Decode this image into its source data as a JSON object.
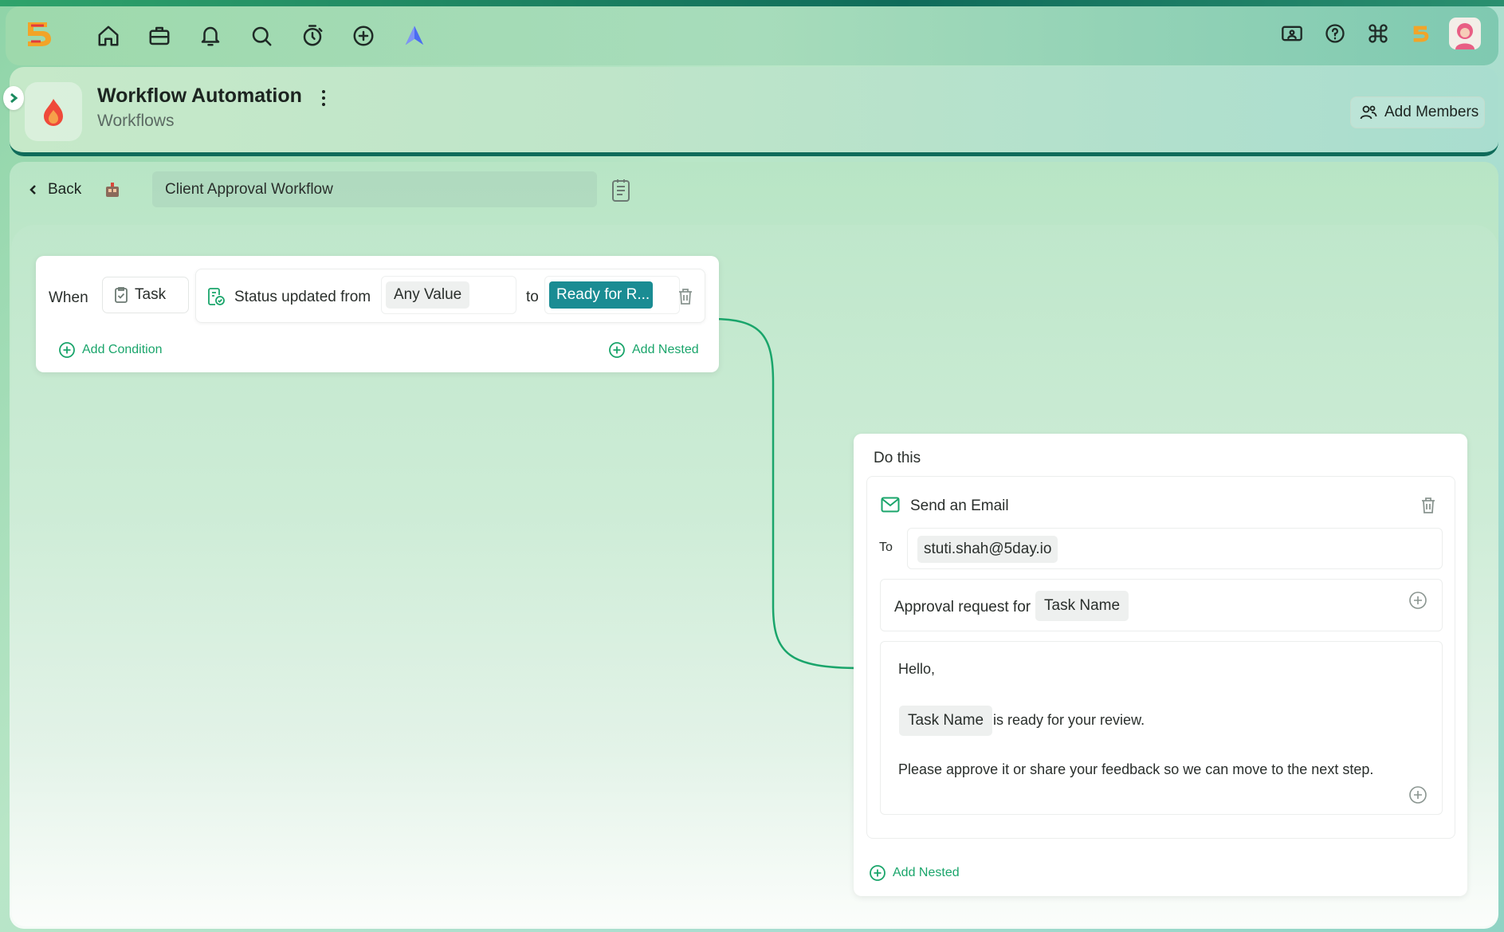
{
  "topnav": {
    "icons": [
      "home-icon",
      "briefcase-icon",
      "bell-icon",
      "search-icon",
      "alarm-icon",
      "plus-circle-icon",
      "arrow-logo-icon"
    ],
    "right_icons": [
      "card-icon",
      "help-icon",
      "command-icon",
      "brand-icon",
      "avatar"
    ]
  },
  "header": {
    "title": "Workflow Automation",
    "subtitle": "Workflows",
    "add_members_label": "Add Members"
  },
  "toolbar": {
    "back_label": "Back",
    "workflow_name": "Client Approval Workflow"
  },
  "trigger": {
    "when_label": "When",
    "entity": "Task",
    "condition_text": "Status updated from",
    "from_value": "Any Value",
    "to_label": "to",
    "to_value": "Ready for R...",
    "add_condition_label": "Add Condition",
    "add_nested_label": "Add Nested"
  },
  "action": {
    "heading": "Do this",
    "type_label": "Send an Email",
    "to_label": "To",
    "to_value": "stuti.shah@5day.io",
    "subject_prefix": "Approval request for",
    "subject_chip": "Task Name",
    "body_greeting": "Hello,",
    "body_chip": "Task Name",
    "body_line": "is ready for your review.",
    "body_para": "Please approve it or share your feedback so we can move to the next step.",
    "add_nested_label": "Add Nested"
  },
  "colors": {
    "accent_green": "#1aa56b",
    "status_teal": "#1a8c93",
    "header_border": "#0f6b5a"
  }
}
